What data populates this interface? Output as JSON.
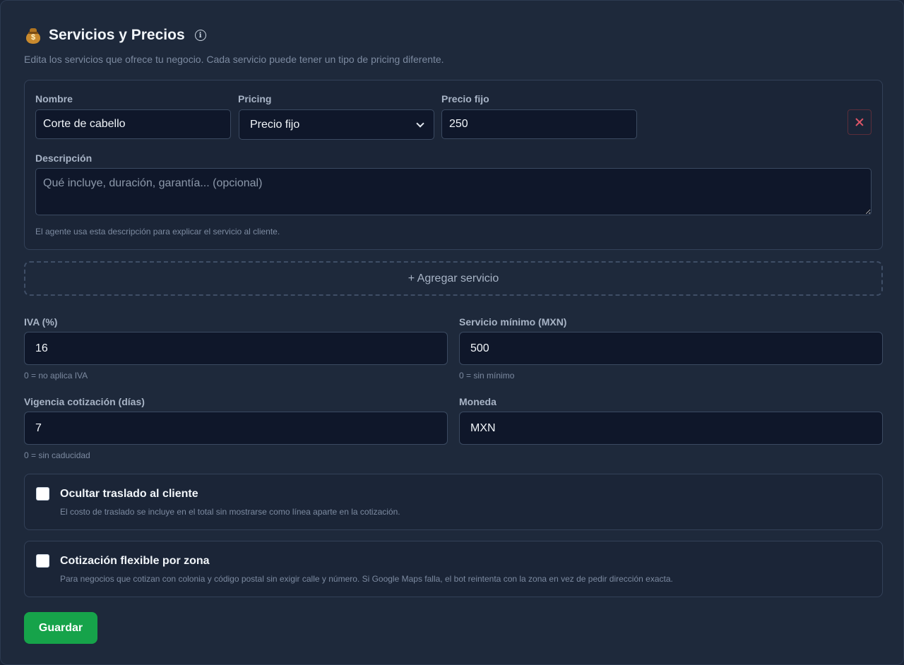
{
  "header": {
    "icon": "money-bag-icon",
    "title": "Servicios y Precios",
    "info_icon": "info-icon",
    "subtitle": "Edita los servicios que ofrece tu negocio. Cada servicio puede tener un tipo de pricing diferente."
  },
  "service": {
    "name_label": "Nombre",
    "name_value": "Corte de cabello",
    "pricing_label": "Pricing",
    "pricing_value": "Precio fijo",
    "price_label": "Precio fijo",
    "price_value": "250",
    "description_label": "Descripción",
    "description_placeholder": "Qué incluye, duración, garantía... (opcional)",
    "description_hint": "El agente usa esta descripción para explicar el servicio al cliente."
  },
  "add_service_label": "+ Agregar servicio",
  "settings": {
    "iva_label": "IVA (%)",
    "iva_value": "16",
    "iva_hint": "0 = no aplica IVA",
    "min_label": "Servicio mínimo (MXN)",
    "min_value": "500",
    "min_hint": "0 = sin mínimo",
    "validity_label": "Vigencia cotización (días)",
    "validity_value": "7",
    "validity_hint": "0 = sin caducidad",
    "currency_label": "Moneda",
    "currency_value": "MXN"
  },
  "options": {
    "hide_travel_title": "Ocultar traslado al cliente",
    "hide_travel_desc": "El costo de traslado se incluye en el total sin mostrarse como línea aparte en la cotización.",
    "hide_travel_checked": false,
    "flex_zone_title": "Cotización flexible por zona",
    "flex_zone_desc": "Para negocios que cotizan con colonia y código postal sin exigir calle y número. Si Google Maps falla, el bot reintenta con la zona en vez de pedir dirección exacta.",
    "flex_zone_checked": false
  },
  "save_label": "Guardar",
  "colors": {
    "background": "#1e293b",
    "input_bg": "#0f172a",
    "accent_green": "#16a34a",
    "danger": "#e05668"
  }
}
